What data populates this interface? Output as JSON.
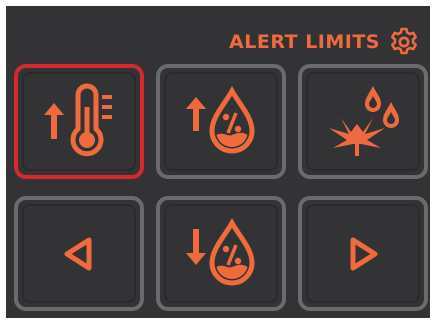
{
  "header": {
    "title": "ALERT LIMITS",
    "settings_icon": "gear-icon"
  },
  "colors": {
    "accent": "#ef6b3e",
    "background": "#333335",
    "tile_border": "#6b6b6e",
    "selected_border": "#d6282f"
  },
  "tiles": [
    {
      "name": "temperature-high-limit",
      "icon": "temperature-up-icon",
      "selected": true
    },
    {
      "name": "humidity-high-limit",
      "icon": "humidity-up-icon",
      "selected": false
    },
    {
      "name": "plant-watering",
      "icon": "cannabis-leaf-water-icon",
      "selected": false
    },
    {
      "name": "previous",
      "icon": "triangle-left-icon",
      "selected": false
    },
    {
      "name": "humidity-low-limit",
      "icon": "humidity-down-icon",
      "selected": false
    },
    {
      "name": "next",
      "icon": "triangle-right-icon",
      "selected": false
    }
  ]
}
